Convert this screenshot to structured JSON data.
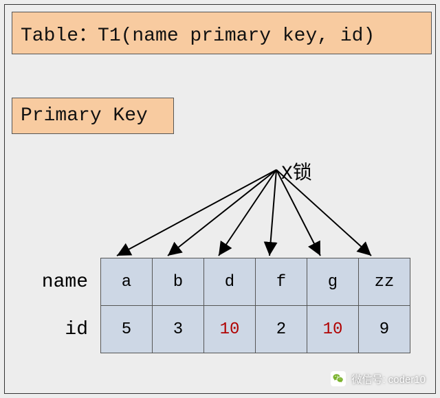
{
  "header": {
    "title": "Table：T1(name primary key, id)"
  },
  "subheader": {
    "label": "Primary Key"
  },
  "lock": {
    "label": "X锁"
  },
  "table": {
    "rowLabels": {
      "r0": "name",
      "r1": "id"
    },
    "cols": [
      {
        "name": "a",
        "id": "5",
        "highlight": false
      },
      {
        "name": "b",
        "id": "3",
        "highlight": false
      },
      {
        "name": "d",
        "id": "10",
        "highlight": true
      },
      {
        "name": "f",
        "id": "2",
        "highlight": false
      },
      {
        "name": "g",
        "id": "10",
        "highlight": true
      },
      {
        "name": "zz",
        "id": "9",
        "highlight": false
      }
    ]
  },
  "footer": {
    "text": "微信号: coder10"
  }
}
